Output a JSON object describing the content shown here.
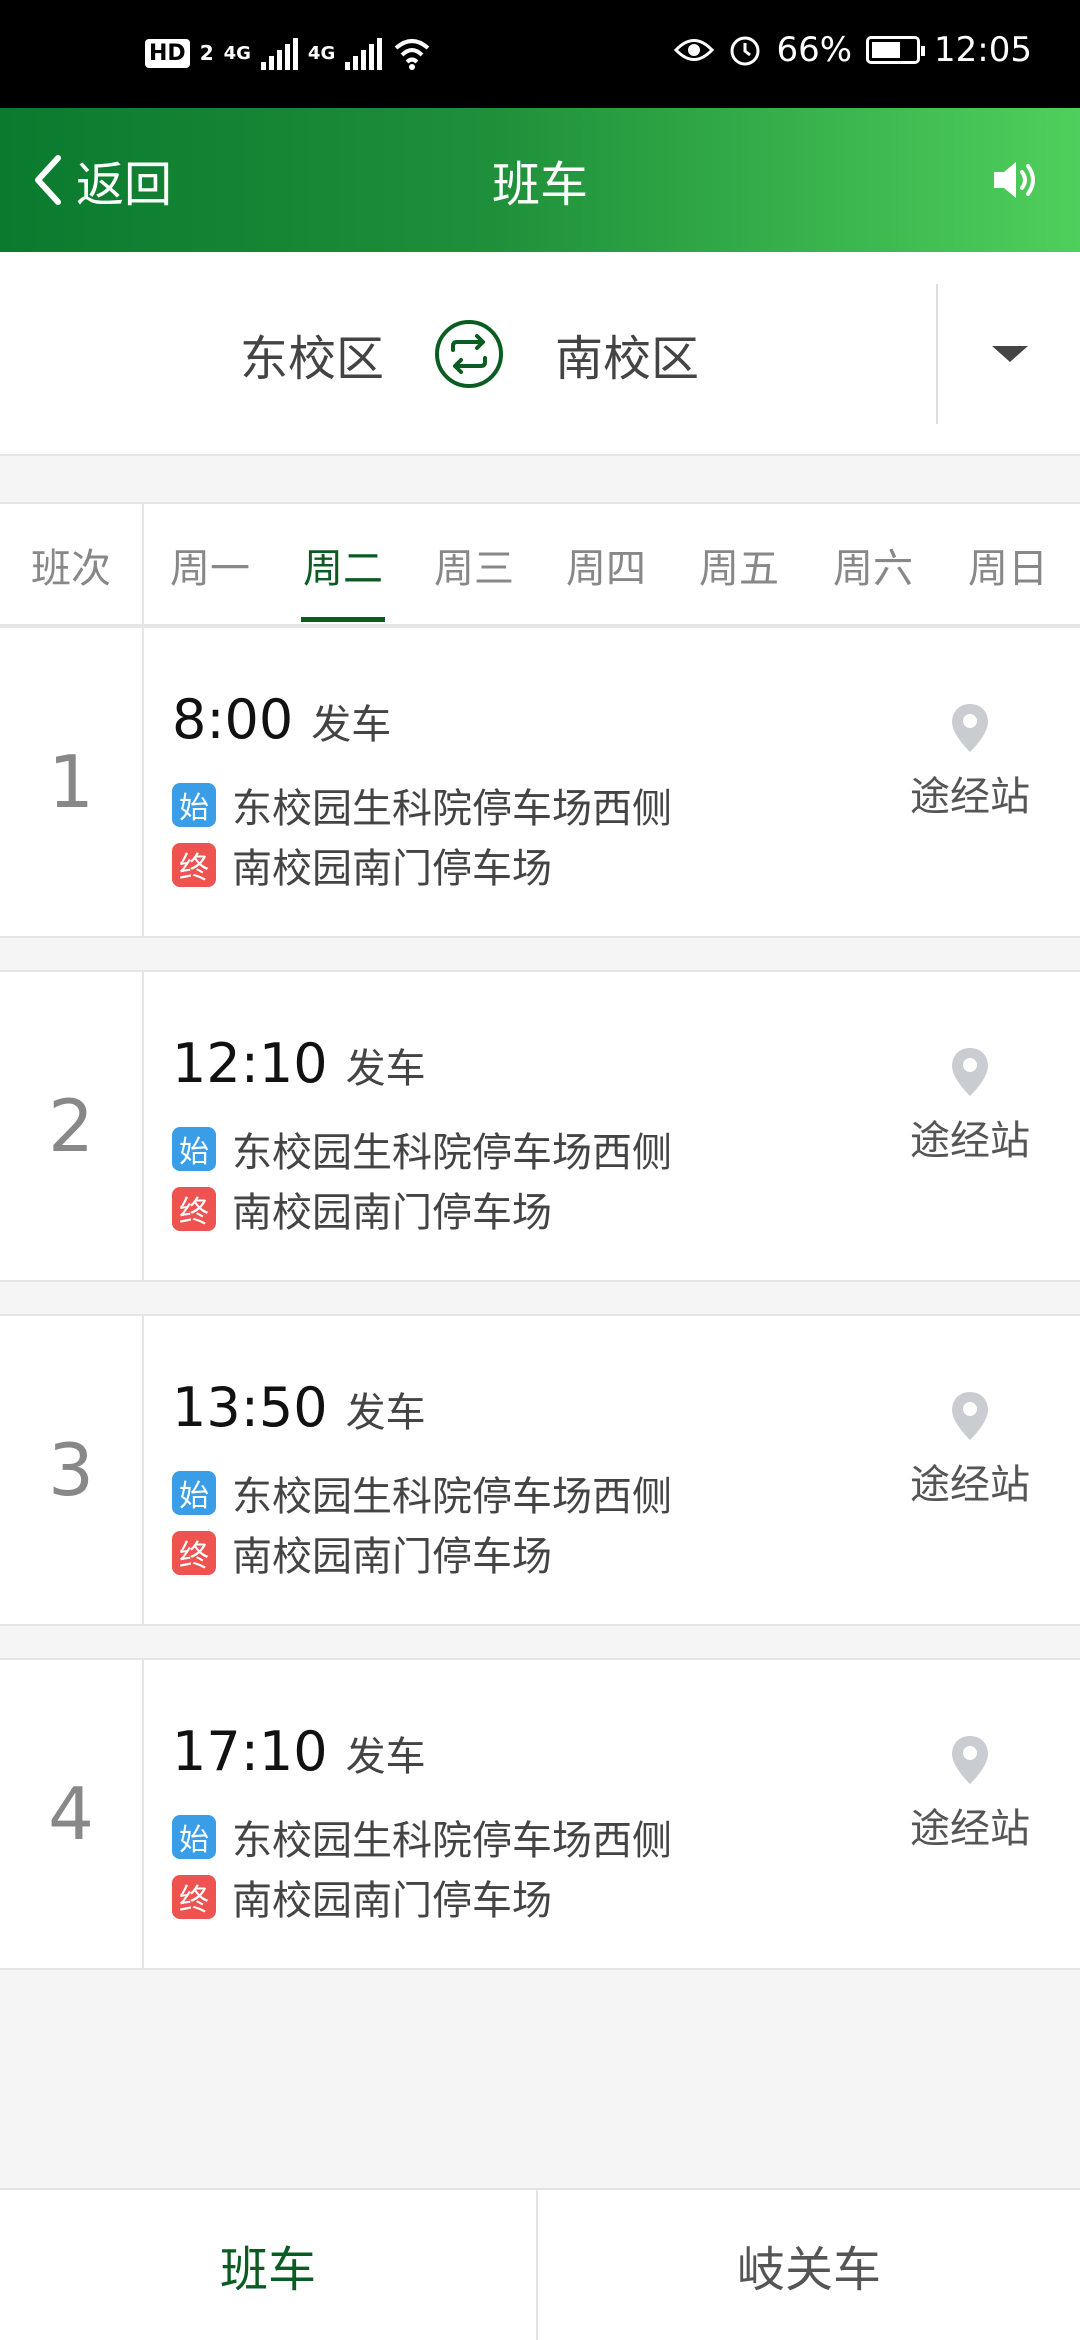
{
  "status_bar": {
    "hd_label": "HD",
    "sim_label": "2",
    "net1": "4G",
    "net2": "4G",
    "battery_percent": "66%",
    "time": "12:05",
    "battery_level": 0.66
  },
  "header": {
    "back_label": "返回",
    "title": "班车",
    "speaker_icon": "speaker-icon",
    "colors": {
      "start": "#0a7a2e",
      "end": "#4fcf5c"
    }
  },
  "route": {
    "from": "东校区",
    "to": "南校区",
    "swap_icon": "swap-icon",
    "dropdown_icon": "caret-down-icon"
  },
  "tabs": {
    "head": "班次",
    "days": [
      "周一",
      "周二",
      "周三",
      "周四",
      "周五",
      "周六",
      "周日"
    ],
    "active_index": 1,
    "accent": "#0a5c22"
  },
  "trips": [
    {
      "num": "1",
      "time": "8:00",
      "depart": "发车",
      "start_badge": "始",
      "start": "东校园生科院停车场西侧",
      "end_badge": "终",
      "end": "南校园南门停车场",
      "via": "途经站"
    },
    {
      "num": "2",
      "time": "12:10",
      "depart": "发车",
      "start_badge": "始",
      "start": "东校园生科院停车场西侧",
      "end_badge": "终",
      "end": "南校园南门停车场",
      "via": "途经站"
    },
    {
      "num": "3",
      "time": "13:50",
      "depart": "发车",
      "start_badge": "始",
      "start": "东校园生科院停车场西侧",
      "end_badge": "终",
      "end": "南校园南门停车场",
      "via": "途经站"
    },
    {
      "num": "4",
      "time": "17:10",
      "depart": "发车",
      "start_badge": "始",
      "start": "东校园生科院停车场西侧",
      "end_badge": "终",
      "end": "南校园南门停车场",
      "via": "途经站"
    }
  ],
  "bottom_tabs": {
    "left": "班车",
    "right": "岐关车"
  }
}
